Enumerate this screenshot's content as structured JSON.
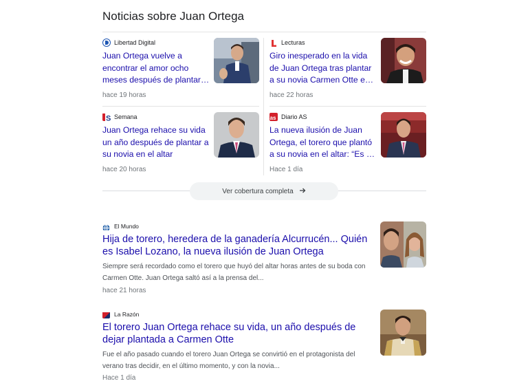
{
  "section": {
    "title": "Noticias sobre Juan Ortega"
  },
  "cards": [
    {
      "source": "Libertad Digital",
      "headline": "Juan Ortega vuelve a encontrar el amor ocho meses después de plantar…",
      "time": "hace 19 horas",
      "icon": "libertad-digital-logo",
      "icon_color": "#1e56b3"
    },
    {
      "source": "Lecturas",
      "headline": "Giro inesperado en la vida de Juan Ortega tras plantar a su novia Carmen Otte e…",
      "time": "hace 22 horas",
      "icon": "lecturas-logo",
      "icon_color": "#e03232"
    },
    {
      "source": "Semana",
      "headline": "Juan Ortega rehace su vida un año después de plantar a su novia en el altar",
      "time": "hace 20 horas",
      "icon": "semana-logo",
      "icon_color": "#1f3d8c"
    },
    {
      "source": "Diario AS",
      "headline": "La nueva ilusión de Juan Ortega, el torero que plantó a su novia en el altar: “Es …",
      "time": "Hace 1 día",
      "icon": "diario-as-logo",
      "icon_color": "#d3202b"
    }
  ],
  "coverage": {
    "label": "Ver cobertura completa"
  },
  "articles": [
    {
      "source": "El Mundo",
      "headline": "Hija de torero, heredera de la ganadería Alcurrucén... Quién es Isabel Lozano, la nueva ilusión de Juan Ortega",
      "snippet": "Siempre será recordado como el torero que huyó del altar horas antes de su boda con Carmen Otte. Juan Ortega saltó así a la prensa del...",
      "time": "hace 21 horas",
      "icon": "el-mundo-logo",
      "icon_color": "#1b5ba6"
    },
    {
      "source": "La Razón",
      "headline": "El torero Juan Ortega rehace su vida, un año después de dejar plantada a Carmen Otte",
      "snippet": "Fue el año pasado cuando el torero Juan Ortega se convirtió en el protagonista del verano tras decidir, en el último momento, y con la novia...",
      "time": "Hace 1 día",
      "icon": "la-razon-logo",
      "icon_color": "#1a2d6b"
    }
  ],
  "colors": {
    "link": "#1a0dab",
    "meta": "#70757a",
    "snippet": "#4d5156",
    "divider": "#e4e4e4",
    "button_bg": "#f1f3f4"
  }
}
